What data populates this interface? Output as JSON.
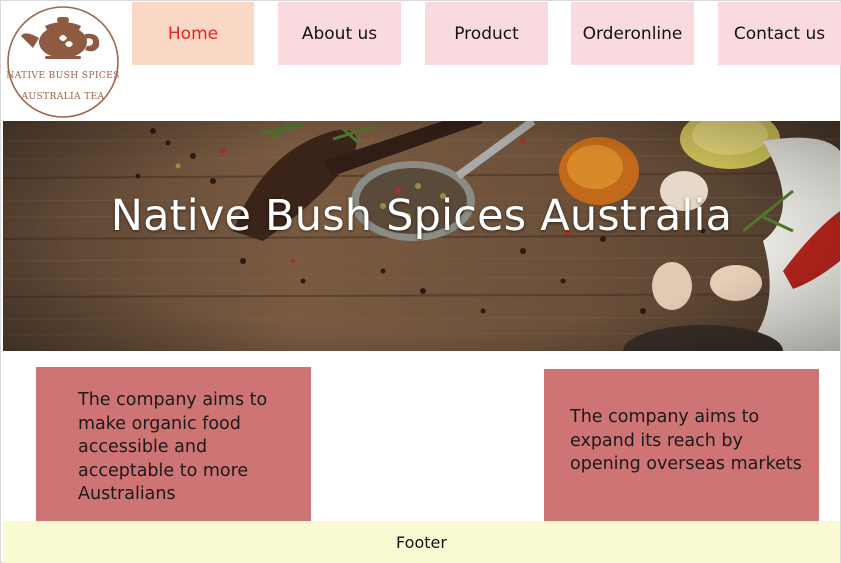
{
  "logo": {
    "line1": "NATIVE BUSH SPICES",
    "line2": "AUSTRALIA TEA",
    "icon": "teapot-icon"
  },
  "nav": {
    "items": [
      {
        "label": "Home",
        "active": true
      },
      {
        "label": "About us",
        "active": false
      },
      {
        "label": "Product",
        "active": false
      },
      {
        "label": "Orderonline",
        "active": false
      },
      {
        "label": "Contact us",
        "active": false
      }
    ]
  },
  "hero": {
    "title": "Native Bush Spices Australia"
  },
  "info": {
    "left_text": "The company aims to make organic food accessible and acceptable to more Australians",
    "right_text": "The company aims to expand its reach by opening overseas markets"
  },
  "footer": {
    "text": "Footer"
  },
  "colors": {
    "nav_bg": "#f9dbdf",
    "nav_active_bg": "#fbd7c6",
    "nav_active_text": "#e8211c",
    "info_bg": "#cf7474",
    "footer_bg": "#fafad2",
    "logo_brown": "#a0644a"
  }
}
